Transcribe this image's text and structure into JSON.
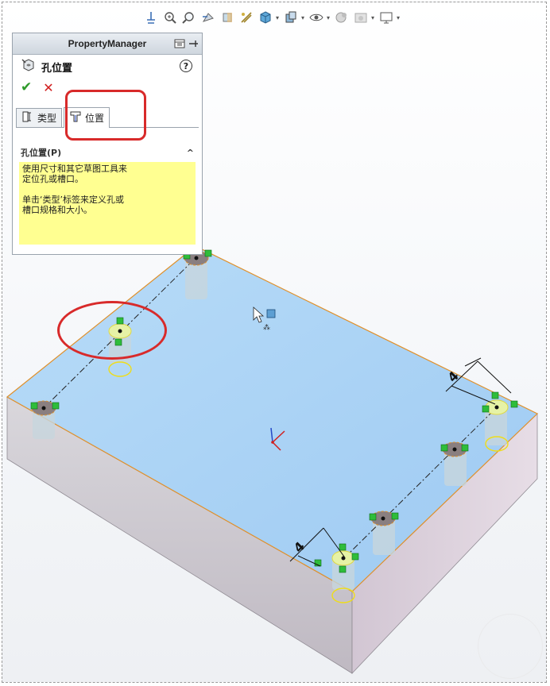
{
  "property_manager": {
    "header_title": "PropertyManager",
    "feature_title": "孔位置",
    "help_label": "?",
    "ok_label": "✔",
    "cancel_label": "✕",
    "tabs": [
      {
        "label": "类型",
        "icon": "hole-type-icon"
      },
      {
        "label": "位置",
        "icon": "hole-position-icon",
        "active": true
      }
    ],
    "group": {
      "title": "孔位置(P)",
      "collapse_label": "^",
      "note_line1a": "使用尺寸和其它草图工具来",
      "note_line1b": "定位孔或槽口。",
      "note_line2a": "单击‘类型’标签来定义孔或",
      "note_line2b": "槽口规格和大小。"
    }
  },
  "toolbar": {
    "icons": [
      "view-normal-icon",
      "zoom-to-fit-icon",
      "zoom-area-icon",
      "previous-view-icon",
      "section-view-icon",
      "dynamic-annotation-icon",
      "view-orientation-icon",
      "display-style-icon",
      "hide-show-icon",
      "edit-appearance-icon",
      "apply-scene-icon",
      "view-settings-icon"
    ]
  },
  "model": {
    "dimension_1": "4",
    "dimension_2": "4"
  },
  "colors": {
    "highlight_red": "#d82a2a",
    "face_blue": "#a8d2f5",
    "edge_orange": "#e0902a",
    "note_yellow": "#ffff91",
    "sketch_green": "#2ebd3a"
  }
}
